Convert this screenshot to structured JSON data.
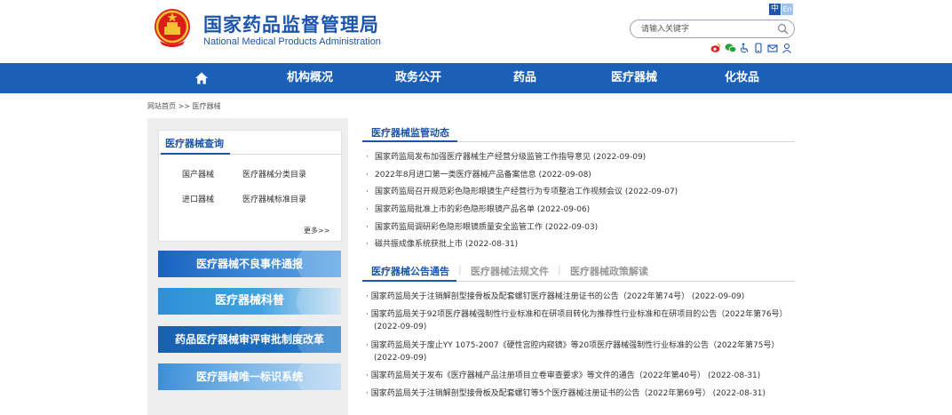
{
  "header": {
    "title": "国家药品监督管理局",
    "subtitle": "National Medical Products Administration",
    "lang_zh": "中",
    "lang_en": "En",
    "search_placeholder": "请输入关键字"
  },
  "nav": {
    "items": [
      "机构概况",
      "政务公开",
      "药品",
      "医疗器械",
      "化妆品"
    ]
  },
  "breadcrumb": {
    "home": "网站首页",
    "sep": " >> ",
    "current": "医疗器械"
  },
  "query": {
    "title": "医疗器械查询",
    "links": [
      "国产器械",
      "医疗器械分类目录",
      "进口器械",
      "医疗器械标准目录"
    ],
    "more": "更多>>"
  },
  "banners": [
    "医疗器械不良事件通报",
    "医疗器械科普",
    "药品医疗器械审评审批制度改革",
    "医疗器械唯一标识系统"
  ],
  "dynamics": {
    "title": "医疗器械监管动态",
    "items": [
      "国家药监局发布加强医疗器械生产经营分级监管工作指导意见 (2022-09-09)",
      "2022年8月进口第一类医疗器械产品备案信息 (2022-09-08)",
      "国家药监局召开规范彩色隐形眼镜生产经营行为专项整治工作视频会议 (2022-09-07)",
      "国家药监局批准上市的彩色隐形眼镜产品名单 (2022-09-06)",
      "国家药监局调研彩色隐形眼镜质量安全监管工作 (2022-09-03)",
      "磁共振成像系统获批上市 (2022-08-31)"
    ]
  },
  "announcements": {
    "tabs": [
      "医疗器械公告通告",
      "医疗器械法规文件",
      "医疗器械政策解读"
    ],
    "items": [
      "国家药监局关于注销解剖型接骨板及配套螺钉医疗器械注册证书的公告（2022年第74号） (2022-09-09)",
      "国家药监局关于92项医疗器械强制性行业标准和在研项目转化为推荐性行业标准和在研项目的公告（2022年第76号） (2022-09-09)",
      "国家药监局关于废止YY 1075-2007《硬性宫腔内窥镜》等20项医疗器械强制性行业标准的公告（2022年第75号） (2022-09-09)",
      "国家药监局关于发布《医疗器械产品注册项目立卷审查要求》等文件的通告（2022年第40号） (2022-08-31)",
      "国家药监局关于注销解剖型接骨板及配套螺钉等5个医疗器械注册证书的公告（2022年第69号） (2022-08-31)"
    ]
  },
  "colors": {
    "brand_blue": "#1c55ad",
    "nav_blue": "#1c5fb6",
    "panel_gray": "#eeeeee"
  },
  "icons": [
    "emblem-icon",
    "search-icon",
    "weibo-icon",
    "wechat-icon",
    "accessibility-icon",
    "mobile-icon",
    "mail-icon",
    "user-icon",
    "home-icon"
  ]
}
